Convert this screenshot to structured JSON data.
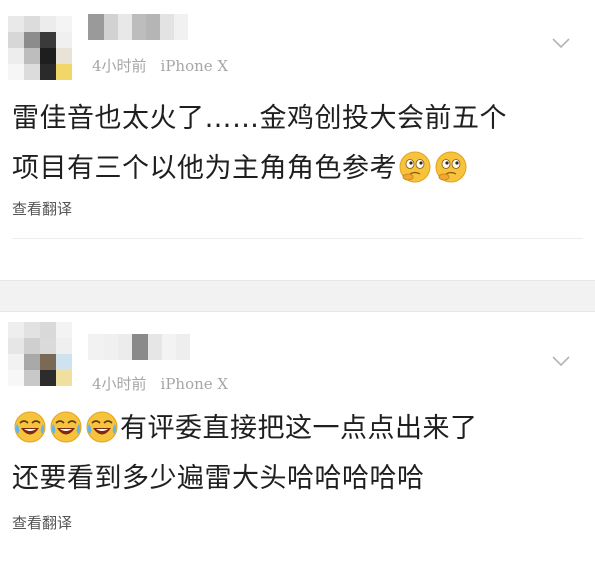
{
  "posts": [
    {
      "time": "4小时前",
      "device": "iPhone X",
      "content_lines": [
        "雷佳音也太火了……金鸡创投大会前五个",
        "项目有三个以他为主角角色参考"
      ],
      "emoji_after": [
        "thinking-face-icon",
        "thinking-face-icon"
      ],
      "translate_label": "查看翻译"
    },
    {
      "time": "4小时前",
      "device": "iPhone X",
      "content_lines": [
        "有评委直接把这一点点出来了",
        "还要看到多少遍雷大头哈哈哈哈哈"
      ],
      "emoji_before": [
        "laughing-crying-face-icon",
        "laughing-crying-face-icon",
        "laughing-crying-face-icon"
      ],
      "translate_label": "查看翻译"
    }
  ],
  "colors": {
    "meta_text": "#a6a6a6",
    "content_text": "#1f1f1f",
    "separator_bg": "#f2f2f2",
    "emoji_yellow": "#f7c23c"
  }
}
